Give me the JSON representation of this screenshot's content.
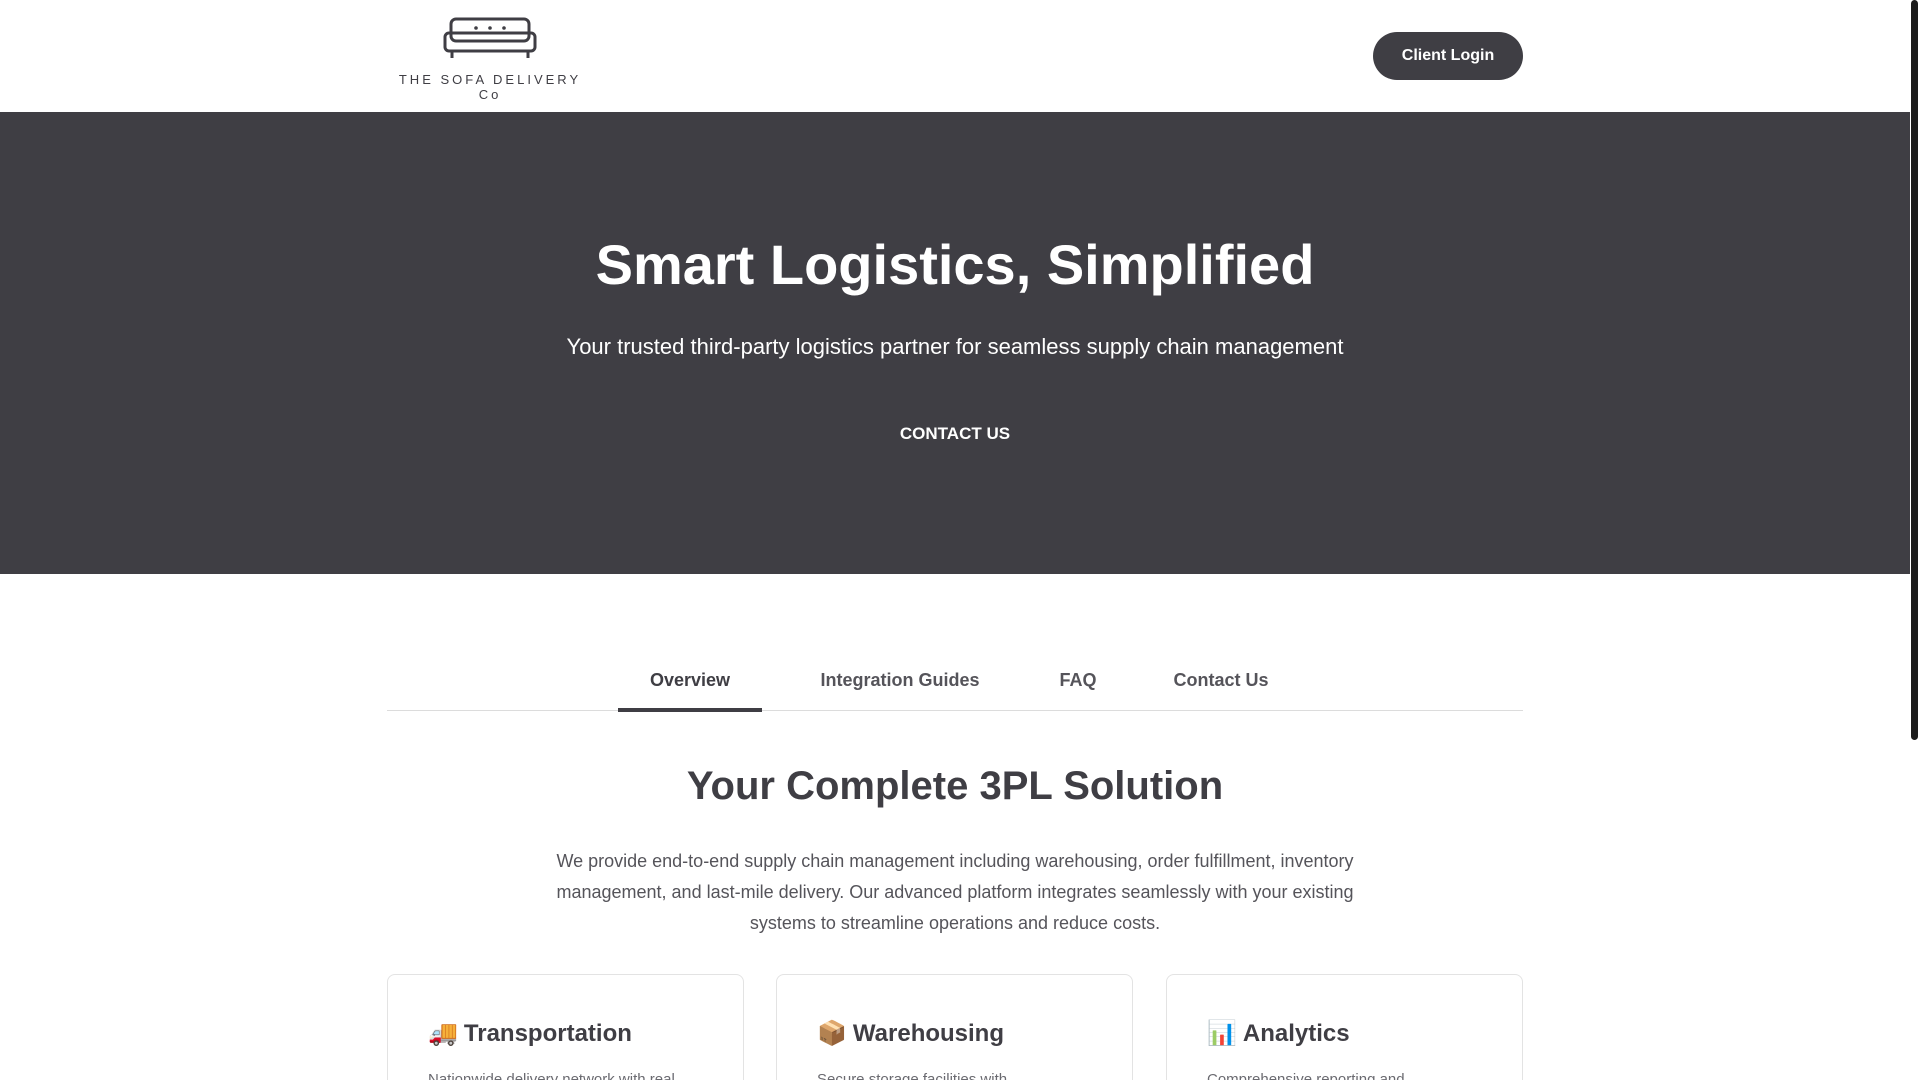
{
  "header": {
    "logo_text": "THE SOFA DELIVERY Co",
    "login_label": "Client Login"
  },
  "hero": {
    "title": "Smart Logistics, Simplified",
    "subtitle": "Your trusted third-party logistics partner for seamless supply chain management",
    "cta_label": "CONTACT US"
  },
  "tabs": [
    {
      "label": "Overview",
      "active": true
    },
    {
      "label": "Integration Guides",
      "active": false
    },
    {
      "label": "FAQ",
      "active": false
    },
    {
      "label": "Contact Us",
      "active": false
    }
  ],
  "section": {
    "title": "Your Complete 3PL Solution",
    "description": "We provide end-to-end supply chain management including warehousing, order fulfillment, inventory management, and last-mile delivery. Our advanced platform integrates seamlessly with your existing systems to streamline operations and reduce costs."
  },
  "cards": [
    {
      "emoji": "🚚",
      "icon": "truck-icon",
      "title": "Transportation",
      "text": "Nationwide delivery network with real"
    },
    {
      "emoji": "📦",
      "icon": "package-icon",
      "title": "Warehousing",
      "text": "Secure storage facilities with"
    },
    {
      "emoji": "📊",
      "icon": "bar-chart-icon",
      "title": "Analytics",
      "text": "Comprehensive reporting and"
    }
  ],
  "colors": {
    "brand_dark": "#3f3e44",
    "background": "#ffffff",
    "text_muted": "#55545a"
  }
}
